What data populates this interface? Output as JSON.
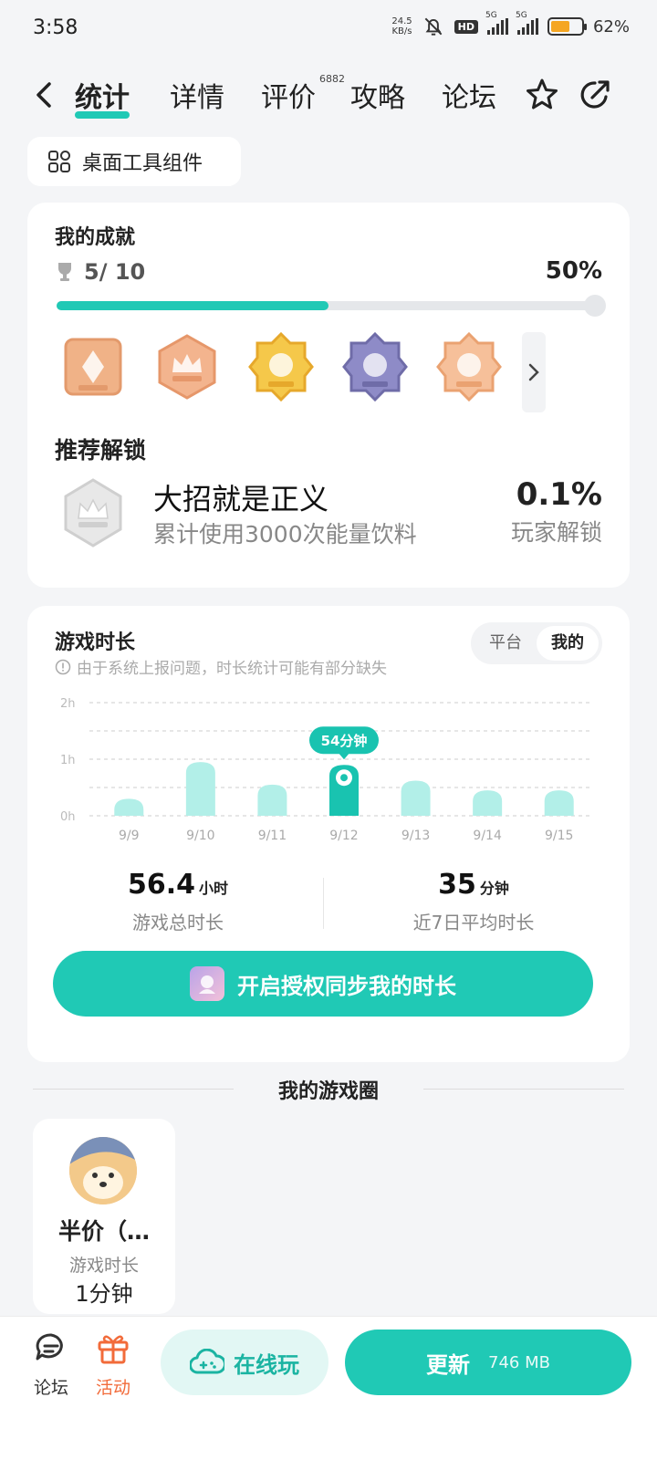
{
  "status_bar": {
    "time": "3:58",
    "net_speed": "24.5",
    "net_unit": "KB/s",
    "hd_label": "HD",
    "sig1_label": "5G",
    "sig2_label": "5G",
    "battery_percent": "62",
    "battery_level": 0.62,
    "battery_color": "#f5a623"
  },
  "nav": {
    "tabs": [
      {
        "label": "统计",
        "active": true
      },
      {
        "label": "详情"
      },
      {
        "label": "评价"
      },
      {
        "label": "攻略"
      },
      {
        "label": "论坛"
      }
    ],
    "review_count": "6882",
    "icons": [
      "back-arrow-icon",
      "star-icon",
      "share-icon"
    ]
  },
  "widget_chip": {
    "label": "桌面工具组件",
    "icon": "widgets-grid-icon"
  },
  "achievements": {
    "title": "我的成就",
    "count_text": "5/ 10",
    "percent_text": "50%",
    "progress": 0.5,
    "badges": [
      {
        "name": "badge-diamond",
        "color": "#f0b287"
      },
      {
        "name": "badge-crown-hexagon",
        "color": "#f3b48e"
      },
      {
        "name": "badge-gold-octagon",
        "color": "#f5c84a"
      },
      {
        "name": "badge-purple-octagon",
        "color": "#8e8bc7"
      },
      {
        "name": "badge-peach-octagon",
        "color": "#f6c09a"
      }
    ],
    "recommend_title": "推荐解锁",
    "recommend": {
      "name": "大招就是正义",
      "desc": "累计使用3000次能量饮料",
      "rate": "0.1%",
      "rate_label": "玩家解锁"
    }
  },
  "play_time": {
    "title": "游戏时长",
    "note": "由于系统上报问题，时长统计可能有部分缺失",
    "segments": [
      {
        "label": "平台"
      },
      {
        "label": "我的",
        "active": true
      }
    ],
    "summary": [
      {
        "value": "56.4",
        "unit": "小时",
        "label": "游戏总时长"
      },
      {
        "value": "35",
        "unit": "分钟",
        "label": "近7日平均时长"
      }
    ],
    "auth_button": "开启授权同步我的时长"
  },
  "chart_data": {
    "type": "bar",
    "categories": [
      "9/9",
      "9/10",
      "9/11",
      "9/12",
      "9/13",
      "9/14",
      "9/15"
    ],
    "values": [
      0.3,
      0.95,
      0.55,
      0.9,
      0.62,
      0.45,
      0.45
    ],
    "y_ticks": [
      "0h",
      "1h",
      "2h"
    ],
    "ylim": [
      0,
      2
    ],
    "highlight_index": 3,
    "highlight_label": "54分钟",
    "bar_color": "#b2efe8",
    "highlight_color": "#19c3b0",
    "grid": true
  },
  "game_circle": {
    "title": "我的游戏圈",
    "card": {
      "name": "半价（…",
      "time_label": "游戏时长",
      "time_value": "1分钟"
    }
  },
  "bottom_bar": {
    "forum": "论坛",
    "events": "活动",
    "play_online": "在线玩",
    "update": "更新",
    "update_size": "746 MB"
  },
  "colors": {
    "accent": "#20c9b5",
    "events": "#f26b3a"
  }
}
